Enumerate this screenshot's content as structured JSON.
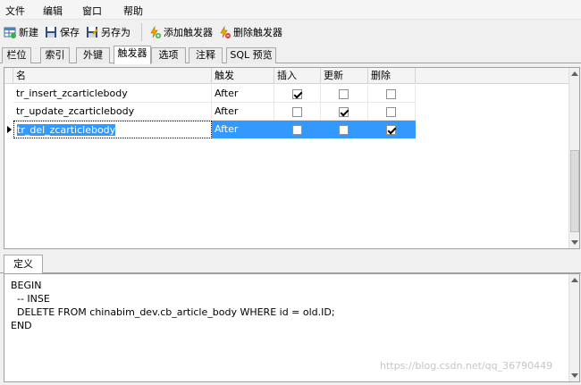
{
  "menu": [
    "文件",
    "编辑",
    "窗口",
    "帮助"
  ],
  "toolbar": {
    "new_label": "新建",
    "save_label": "保存",
    "save_as_label": "另存为",
    "add_trigger_label": "添加触发器",
    "delete_trigger_label": "删除触发器"
  },
  "tabs": [
    "栏位",
    "索引",
    "外键",
    "触发器",
    "选项",
    "注释",
    "SQL 预览"
  ],
  "active_tab": "触发器",
  "grid": {
    "columns": [
      "名",
      "触发",
      "插入",
      "更新",
      "删除"
    ],
    "rows": [
      {
        "name": "tr_insert_zcarticlebody",
        "timing": "After",
        "insert": true,
        "update": false,
        "delete": false
      },
      {
        "name": "tr_update_zcarticlebody",
        "timing": "After",
        "insert": false,
        "update": true,
        "delete": false
      },
      {
        "name": "tr_del_zcarticlebody",
        "timing": "After",
        "insert": false,
        "update": false,
        "delete": true
      }
    ],
    "selected_row": 2
  },
  "definition": {
    "tab_label": "定义",
    "code": "BEGIN\n  -- INSE\n  DELETE FROM chinabim_dev.cb_article_body WHERE id = old.ID;\nEND"
  },
  "watermark": "https://blog.csdn.net/qq_36790449",
  "colors": {
    "selection": "#3399ff",
    "panel_bg": "#f0f0f0"
  }
}
